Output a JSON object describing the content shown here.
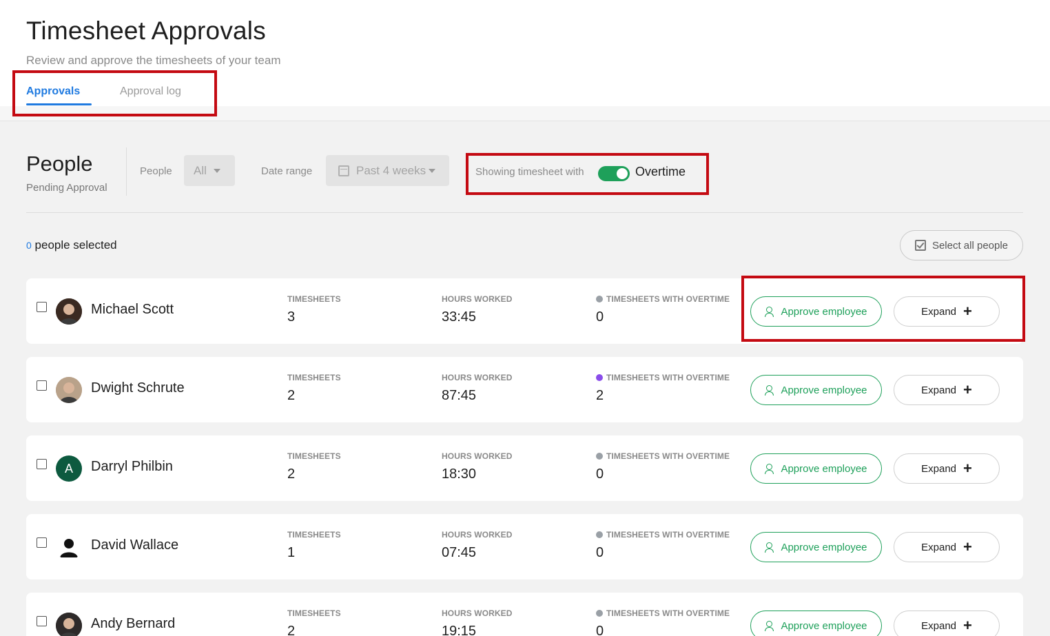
{
  "header": {
    "title": "Timesheet Approvals",
    "subtitle": "Review and approve the timesheets of your team"
  },
  "tabs": [
    {
      "label": "Approvals",
      "active": true
    },
    {
      "label": "Approval log",
      "active": false
    }
  ],
  "filters": {
    "section_title": "People",
    "section_subtitle": "Pending Approval",
    "people_label": "People",
    "people_value": "All",
    "date_range_label": "Date range",
    "date_range_value": "Past 4 weeks",
    "showing_text": "Showing timesheet with",
    "overtime_label": "Overtime",
    "overtime_enabled": true
  },
  "selection": {
    "count": "0",
    "suffix": "people selected",
    "select_all_label": "Select all people"
  },
  "columns": {
    "timesheets": "TIMESHEETS",
    "hours_worked": "HOURS WORKED",
    "overtime": "TIMESHEETS WITH OVERTIME"
  },
  "actions": {
    "approve_label": "Approve employee",
    "expand_label": "Expand"
  },
  "employees": [
    {
      "name": "Michael Scott",
      "timesheets": "3",
      "hours": "33:45",
      "overtime": "0",
      "avatar": "photo",
      "avatar_color": "#3a2a22"
    },
    {
      "name": "Dwight Schrute",
      "timesheets": "2",
      "hours": "87:45",
      "overtime": "2",
      "avatar": "photo",
      "avatar_color": "#b9a28a"
    },
    {
      "name": "Darryl Philbin",
      "timesheets": "2",
      "hours": "18:30",
      "overtime": "0",
      "avatar": "A",
      "avatar_color": "#0d5a3f"
    },
    {
      "name": "David Wallace",
      "timesheets": "1",
      "hours": "07:45",
      "overtime": "0",
      "avatar": "silhouette",
      "avatar_color": "#ffffff"
    },
    {
      "name": "Andy Bernard",
      "timesheets": "2",
      "hours": "19:15",
      "overtime": "0",
      "avatar": "photo",
      "avatar_color": "#2e2a2a"
    }
  ],
  "colors": {
    "accent_blue": "#1f7ae0",
    "approve_green": "#1ea05a",
    "highlight_red": "#c40a12",
    "overtime_purple": "#8a4dea"
  }
}
